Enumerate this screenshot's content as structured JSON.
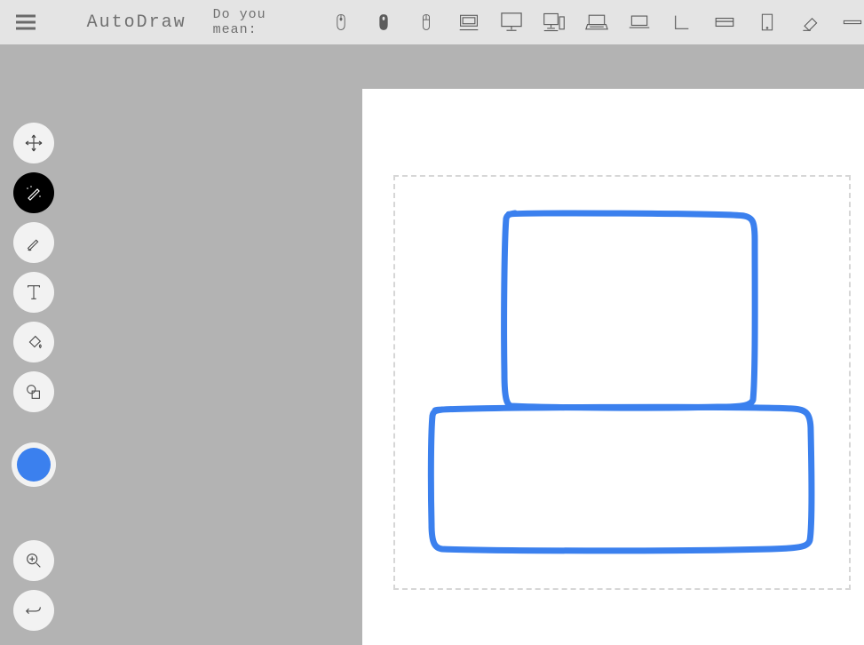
{
  "app_title": "AutoDraw",
  "suggest_label": "Do you mean:",
  "suggestions": [
    "mouse-1-icon",
    "mouse-2-icon",
    "mouse-3-icon",
    "monitor-1-icon",
    "monitor-2-icon",
    "desktop-icon",
    "laptop-1-icon",
    "laptop-2-icon",
    "angle-icon",
    "tray-icon",
    "tablet-icon",
    "eraser-icon",
    "minus-icon"
  ],
  "tools": {
    "move": "select-move",
    "autodraw": "autodraw",
    "draw": "draw",
    "text": "text",
    "fill": "fill",
    "shape": "shape",
    "zoom": "zoom",
    "undo": "undo"
  },
  "current_color": "#3b80ee"
}
